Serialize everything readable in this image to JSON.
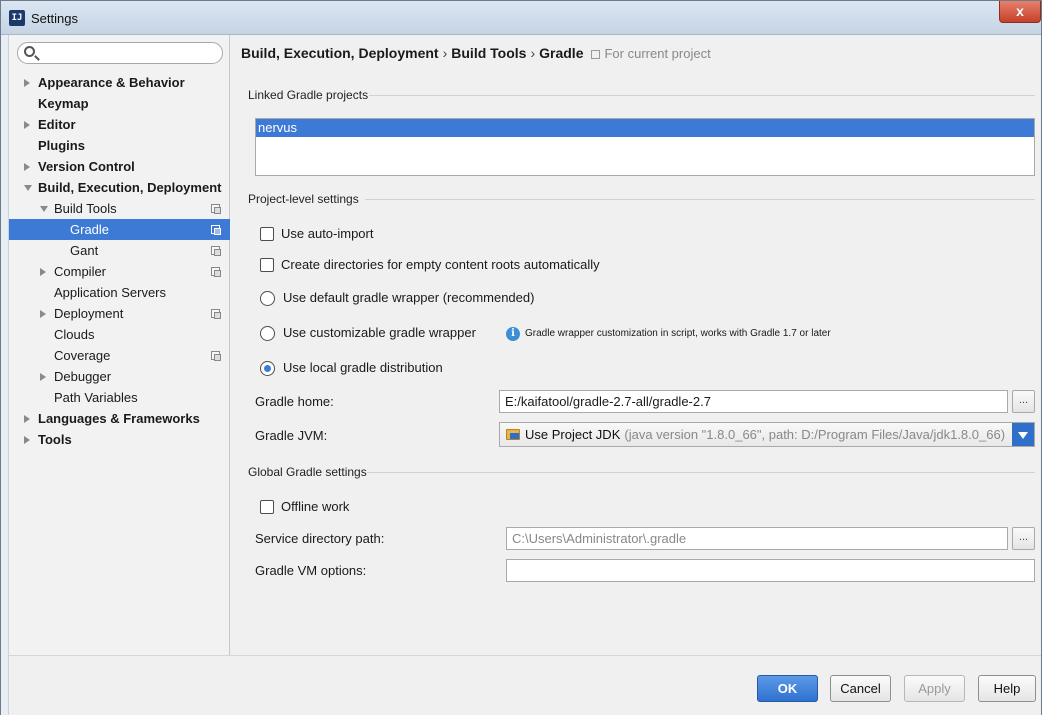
{
  "window": {
    "title": "Settings",
    "app_icon": "intellij-icon",
    "close": "x"
  },
  "search": {
    "placeholder": "",
    "value": ""
  },
  "tree": [
    {
      "label": "Appearance & Behavior",
      "bold": true,
      "level": 0,
      "arrow": "right",
      "project": false,
      "selected": false
    },
    {
      "label": "Keymap",
      "bold": true,
      "level": 0,
      "arrow": "none",
      "project": false,
      "selected": false
    },
    {
      "label": "Editor",
      "bold": true,
      "level": 0,
      "arrow": "right",
      "project": false,
      "selected": false
    },
    {
      "label": "Plugins",
      "bold": true,
      "level": 0,
      "arrow": "none",
      "project": false,
      "selected": false
    },
    {
      "label": "Version Control",
      "bold": true,
      "level": 0,
      "arrow": "right",
      "project": false,
      "selected": false
    },
    {
      "label": "Build, Execution, Deployment",
      "bold": true,
      "level": 0,
      "arrow": "down",
      "project": false,
      "selected": false
    },
    {
      "label": "Build Tools",
      "bold": false,
      "level": 1,
      "arrow": "down",
      "project": true,
      "selected": false
    },
    {
      "label": "Gradle",
      "bold": false,
      "level": 2,
      "arrow": "none",
      "project": true,
      "selected": true
    },
    {
      "label": "Gant",
      "bold": false,
      "level": 2,
      "arrow": "none",
      "project": true,
      "selected": false
    },
    {
      "label": "Compiler",
      "bold": false,
      "level": 1,
      "arrow": "right",
      "project": true,
      "selected": false
    },
    {
      "label": "Application Servers",
      "bold": false,
      "level": 1,
      "arrow": "none",
      "project": false,
      "selected": false
    },
    {
      "label": "Deployment",
      "bold": false,
      "level": 1,
      "arrow": "right",
      "project": true,
      "selected": false
    },
    {
      "label": "Clouds",
      "bold": false,
      "level": 1,
      "arrow": "none",
      "project": false,
      "selected": false
    },
    {
      "label": "Coverage",
      "bold": false,
      "level": 1,
      "arrow": "none",
      "project": true,
      "selected": false
    },
    {
      "label": "Debugger",
      "bold": false,
      "level": 1,
      "arrow": "right",
      "project": false,
      "selected": false
    },
    {
      "label": "Path Variables",
      "bold": false,
      "level": 1,
      "arrow": "none",
      "project": false,
      "selected": false
    },
    {
      "label": "Languages & Frameworks",
      "bold": true,
      "level": 0,
      "arrow": "right",
      "project": false,
      "selected": false
    },
    {
      "label": "Tools",
      "bold": true,
      "level": 0,
      "arrow": "right",
      "project": false,
      "selected": false
    }
  ],
  "breadcrumb": {
    "items": [
      "Build, Execution, Deployment",
      "Build Tools",
      "Gradle"
    ],
    "separator": "›",
    "scope": "For current project"
  },
  "linked": {
    "title": "Linked Gradle projects",
    "projects": [
      "nervus"
    ]
  },
  "project_level": {
    "title": "Project-level settings",
    "auto_import": "Use auto-import",
    "create_dirs": "Create directories for empty content roots automatically",
    "default_wrapper": "Use default gradle wrapper (recommended)",
    "custom_wrapper": "Use customizable gradle wrapper",
    "custom_wrapper_note": "Gradle wrapper customization in script, works with Gradle 1.7 or later",
    "local_distribution": "Use local gradle distribution",
    "selected_distribution": "local",
    "gradle_home_label": "Gradle home:",
    "gradle_home_value": "E:/kaifatool/gradle-2.7-all/gradle-2.7",
    "gradle_jvm_label": "Gradle JVM:",
    "gradle_jvm_value": "Use Project JDK",
    "gradle_jvm_detail": "(java version \"1.8.0_66\", path: D:/Program Files/Java/jdk1.8.0_66)"
  },
  "global": {
    "title": "Global Gradle settings",
    "offline_work": "Offline work",
    "service_dir_label": "Service directory path:",
    "service_dir_value": "C:\\Users\\Administrator\\.gradle",
    "vm_options_label": "Gradle VM options:",
    "vm_options_value": ""
  },
  "browse_label": "...",
  "buttons": {
    "ok": "OK",
    "cancel": "Cancel",
    "apply": "Apply",
    "help": "Help"
  },
  "colors": {
    "selection": "#3d7ad6",
    "primary_button": "#2f72cf"
  }
}
